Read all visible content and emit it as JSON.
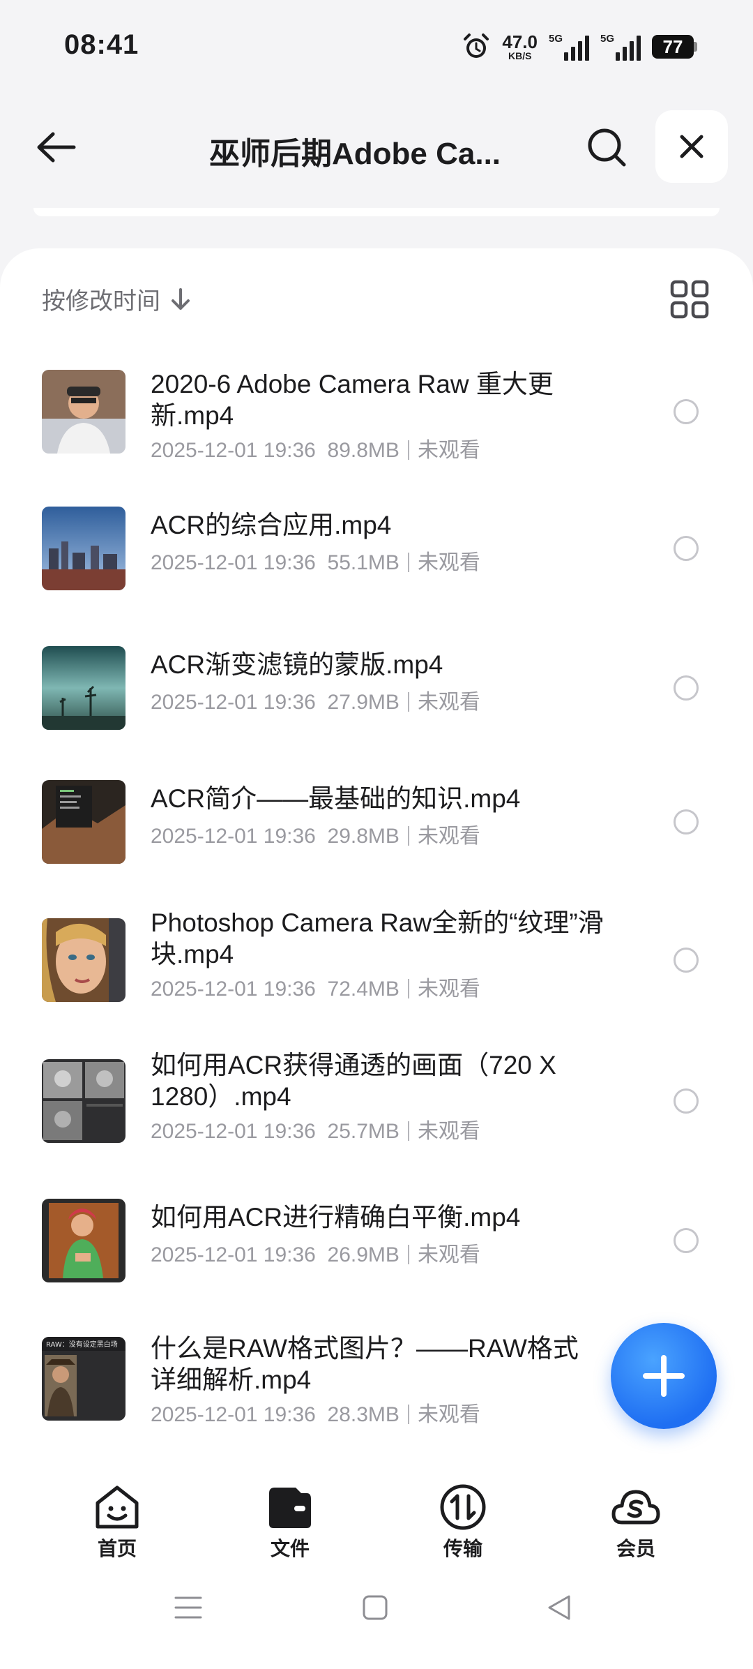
{
  "status_bar": {
    "time": "08:41",
    "net_speed": "47.0",
    "net_unit": "KB/S",
    "sim1": "5G",
    "sim2": "5G",
    "battery": "77"
  },
  "header": {
    "title": "巫师后期Adobe Ca..."
  },
  "toolbar": {
    "sort_label": "按修改时间"
  },
  "files": [
    {
      "name": "2020-6 Adobe Camera Raw 重大更新.mp4",
      "date": "2025-12-01 19:36",
      "size": "89.8MB",
      "status": "未观看"
    },
    {
      "name": "ACR的综合应用.mp4",
      "date": "2025-12-01 19:36",
      "size": "55.1MB",
      "status": "未观看"
    },
    {
      "name": "ACR渐变滤镜的蒙版.mp4",
      "date": "2025-12-01 19:36",
      "size": "27.9MB",
      "status": "未观看"
    },
    {
      "name": "ACR简介——最基础的知识.mp4",
      "date": "2025-12-01 19:36",
      "size": "29.8MB",
      "status": "未观看"
    },
    {
      "name": "Photoshop Camera Raw全新的“纹理”滑块.mp4",
      "date": "2025-12-01 19:36",
      "size": "72.4MB",
      "status": "未观看"
    },
    {
      "name": "如何用ACR获得通透的画面（720 X 1280）.mp4",
      "date": "2025-12-01 19:36",
      "size": "25.7MB",
      "status": "未观看"
    },
    {
      "name": "如何用ACR进行精确白平衡.mp4",
      "date": "2025-12-01 19:36",
      "size": "26.9MB",
      "status": "未观看"
    },
    {
      "name": "什么是RAW格式图片？——RAW格式详细解析.mp4",
      "date": "2025-12-01 19:36",
      "size": "28.3MB",
      "status": "未观看"
    }
  ],
  "thumb_caption": "RAW：没有设定黑白场",
  "bottom_nav": [
    {
      "label": "首页",
      "icon": "home-face-icon"
    },
    {
      "label": "文件",
      "icon": "wallet-file-icon"
    },
    {
      "label": "传输",
      "icon": "transfer-icon"
    },
    {
      "label": "会员",
      "icon": "member-cloud-icon"
    }
  ],
  "colors": {
    "accent": "#1f6ff2",
    "background": "#f4f4f6",
    "meta_text": "#9a9aa0"
  }
}
